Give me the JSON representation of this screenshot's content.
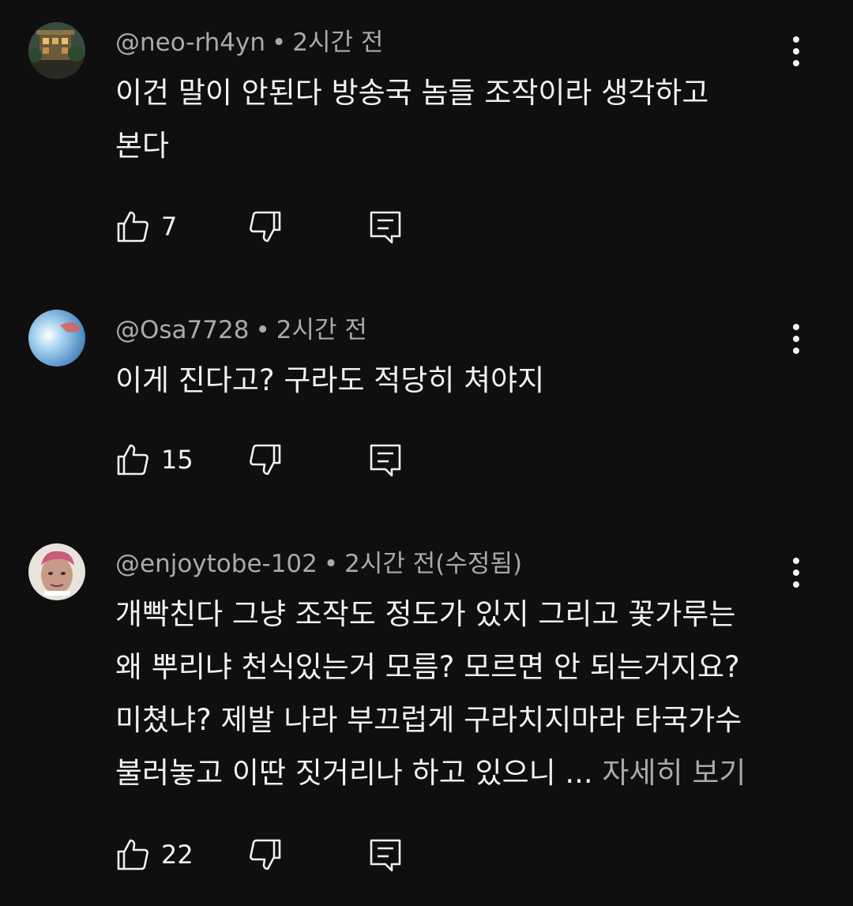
{
  "comments": [
    {
      "author": "@neo-rh4yn",
      "separator": "•",
      "time": "2시간 전",
      "lines": [
        "이건 말이 안된다 방송국 놈들 조작이라 생각하고",
        "본다"
      ],
      "likes": "7",
      "avatar_icon": "building-avatar"
    },
    {
      "author": "@Osa7728",
      "separator": "•",
      "time": "2시간 전",
      "lines": [
        "이게 진다고? 구라도 적당히 쳐야지"
      ],
      "likes": "15",
      "avatar_icon": "blue-sky-avatar"
    },
    {
      "author": "@enjoytobe-102",
      "separator": "•",
      "time": "2시간 전(수정됨)",
      "lines": [
        "개빡친다 그냥 조작도 정도가 있지 그리고 꽃가루는",
        "왜 뿌리냐 천식있는거 모름? 모르면 안 되는거지요?",
        "미쳤냐? 제발 나라 부끄럽게 구라치지마라 타국가수",
        "불러놓고 이딴 짓거리나 하고 있으니 ..."
      ],
      "more_label": "자세히 보기",
      "likes": "22",
      "avatar_icon": "person-avatar"
    }
  ],
  "icons": {
    "like": "thumbs-up-icon",
    "dislike": "thumbs-down-icon",
    "reply": "reply-icon",
    "menu": "more-vertical-icon"
  },
  "colors": {
    "background": "#0f0f0f",
    "text": "#f1f1f1",
    "secondary": "#aaaaaa"
  }
}
